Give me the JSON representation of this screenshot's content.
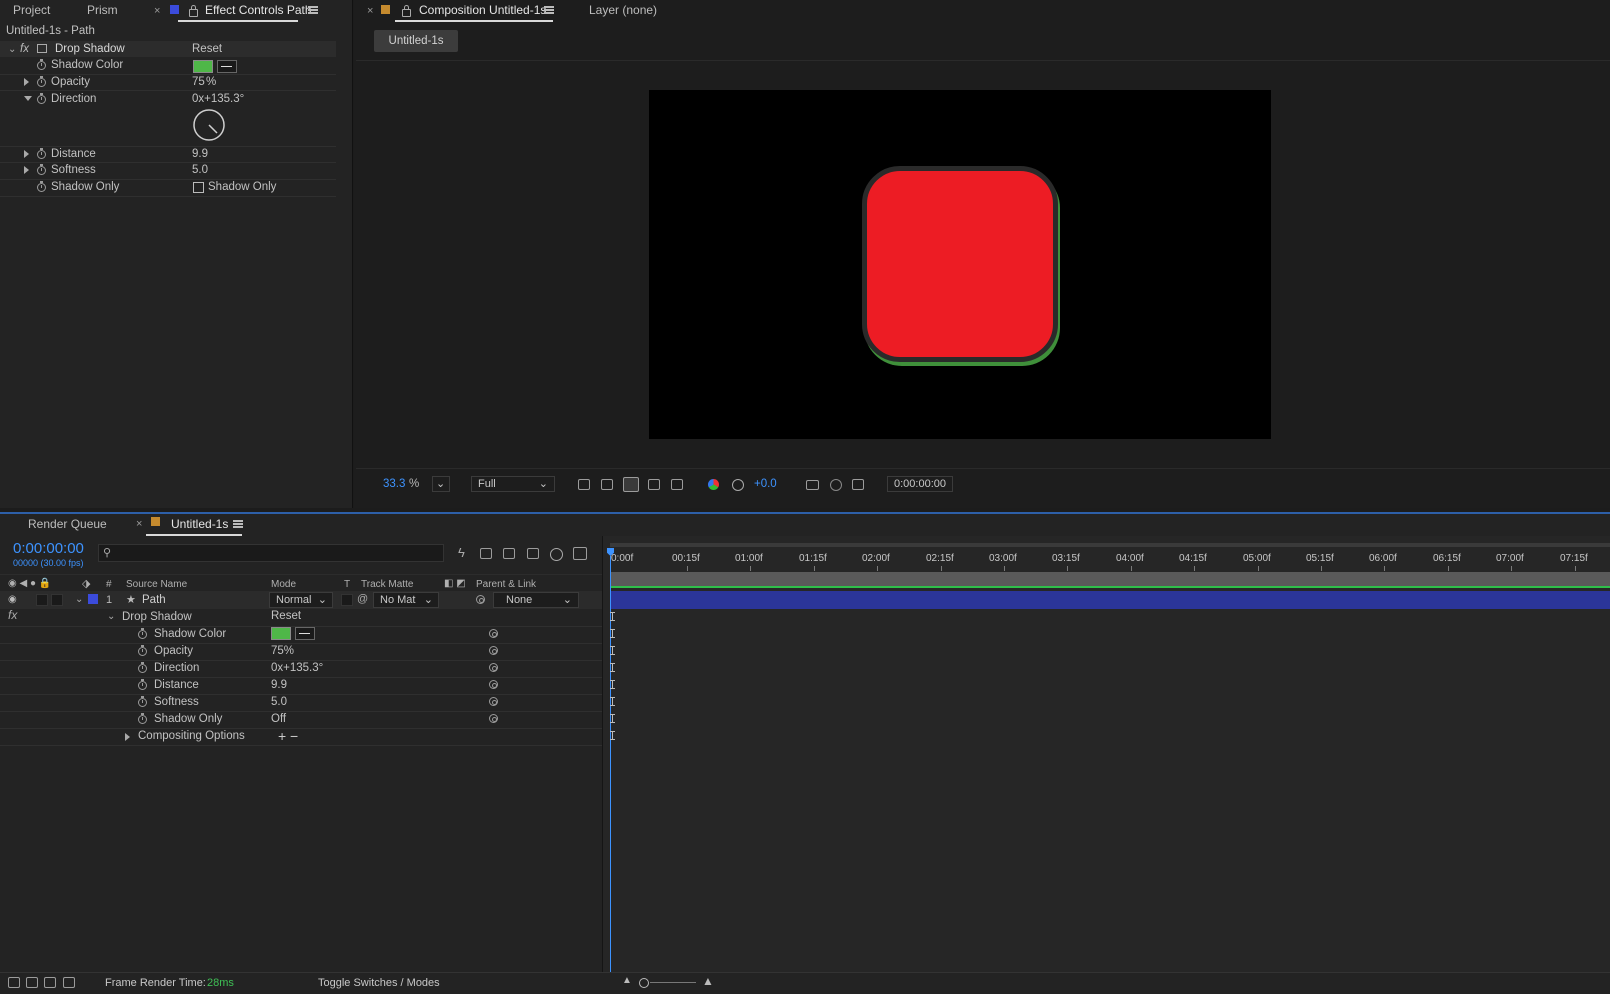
{
  "effect_controls_panel": {
    "tabs": [
      "Project",
      "Prism",
      "Effect Controls Path"
    ],
    "layer_title": "Untitled-1s - Path",
    "effect_name": "Drop Shadow",
    "reset_label": "Reset",
    "properties": {
      "shadow_color": {
        "label": "Shadow Color",
        "color": "#4fb748"
      },
      "opacity": {
        "label": "Opacity",
        "value": "75",
        "unit": "%"
      },
      "direction": {
        "label": "Direction",
        "value": "0x+135.3°"
      },
      "distance": {
        "label": "Distance",
        "value": "9.9"
      },
      "softness": {
        "label": "Softness",
        "value": "5.0"
      },
      "shadow_only": {
        "label": "Shadow Only",
        "checkbox_label": "Shadow Only",
        "checked": false
      }
    }
  },
  "composition_panel": {
    "tab_label": "Composition Untitled-1s",
    "layer_tab_label": "Layer (none)",
    "comp_chip": "Untitled-1s",
    "bottom_bar": {
      "zoom": "33.3",
      "zoom_unit": "%",
      "resolution": "Full",
      "exposure": "+0.0",
      "timecode": "0:00:00:00"
    },
    "shape_color": "#ed1c24",
    "shadow_color": "#3f8f3a"
  },
  "timeline_panel": {
    "tabs": [
      "Render Queue",
      "Untitled-1s"
    ],
    "timecode": "0:00:00:00",
    "frame_info": "00000 (30.00 fps)",
    "column_headers": {
      "number": "#",
      "source_name": "Source Name",
      "mode": "Mode",
      "t": "T",
      "track_matte": "Track Matte",
      "parent_link": "Parent & Link"
    },
    "layer": {
      "index": "1",
      "name": "Path",
      "mode": "Normal",
      "track_matte": "No Mat",
      "parent": "None",
      "label_color": "#3b4bdb"
    },
    "effect": {
      "name": "Drop Shadow",
      "reset_label": "Reset",
      "properties": [
        {
          "label": "Shadow Color",
          "value": ""
        },
        {
          "label": "Opacity",
          "value": "75%"
        },
        {
          "label": "Direction",
          "value": "0x+135.3°"
        },
        {
          "label": "Distance",
          "value": "9.9"
        },
        {
          "label": "Softness",
          "value": "5.0"
        },
        {
          "label": "Shadow Only",
          "value": "Off"
        }
      ]
    },
    "compositing_options": "Compositing Options",
    "ruler_labels": [
      "00:15f",
      "01:00f",
      "01:15f",
      "02:00f",
      "02:15f",
      "03:00f",
      "03:15f",
      "04:00f",
      "04:15f",
      "05:00f",
      "05:15f",
      "06:00f",
      "06:15f",
      "07:00f",
      "07:15f"
    ],
    "ruler_start_label": "0:00f",
    "footer": {
      "frame_render_label": "Frame Render Time:",
      "frame_render_value": "28ms",
      "toggle_label": "Toggle Switches / Modes"
    }
  }
}
